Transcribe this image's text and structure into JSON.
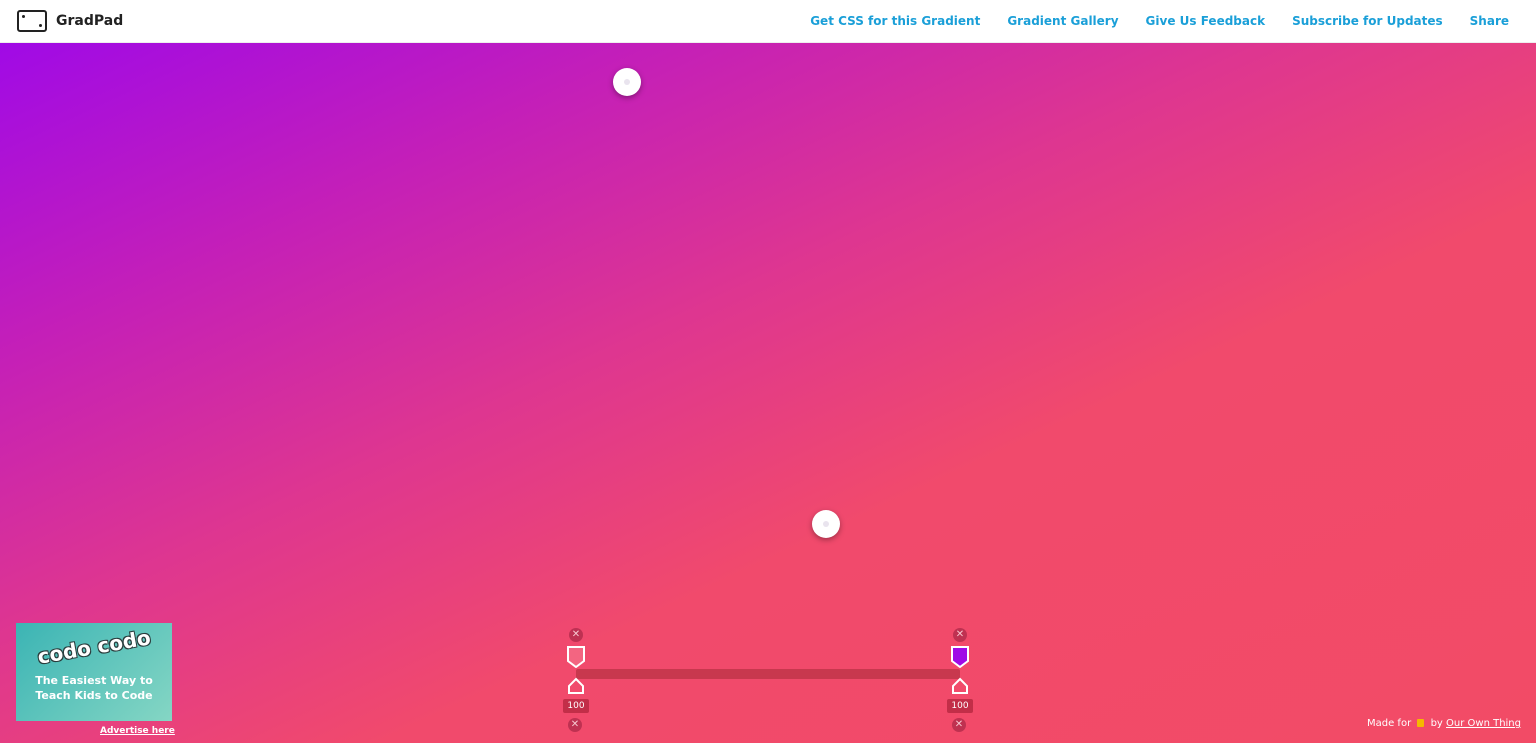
{
  "app": {
    "name": "GradPad"
  },
  "nav": [
    {
      "label": "Get CSS for this Gradient"
    },
    {
      "label": "Gradient Gallery"
    },
    {
      "label": "Give Us Feedback"
    },
    {
      "label": "Subscribe for Updates"
    },
    {
      "label": "Share"
    }
  ],
  "gradient": {
    "colors": [
      "#a00ae6",
      "#f24b66"
    ]
  },
  "stops": [
    {
      "value": "100",
      "color": "#ffffff"
    },
    {
      "value": "100",
      "color": "#a00ae6"
    }
  ],
  "ad": {
    "logo": "codo codo",
    "text": "The Easiest Way to Teach Kids to Code",
    "link": "Advertise here"
  },
  "footer": {
    "made_for": "Made for",
    "by": "by",
    "link": "Our Own Thing"
  }
}
